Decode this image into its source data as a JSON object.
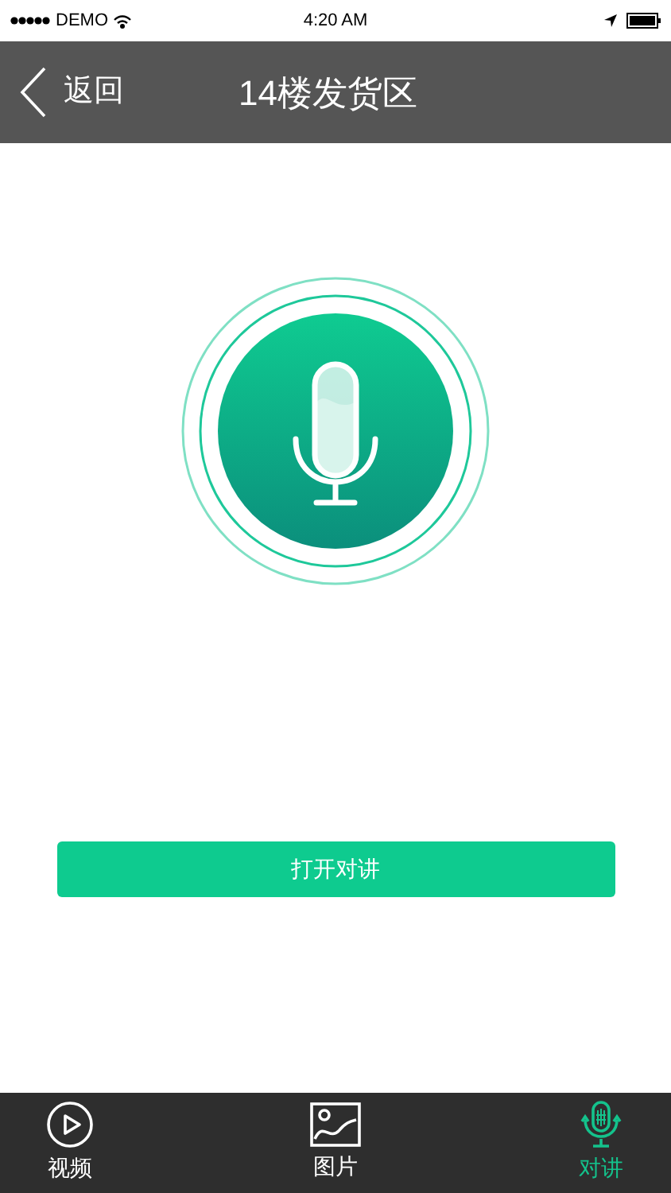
{
  "status_bar": {
    "carrier": "DEMO",
    "time": "4:20 AM"
  },
  "nav": {
    "back": "返回",
    "title": "14楼发货区"
  },
  "action_button": "打开对讲",
  "tabs": [
    {
      "kind": "video",
      "label": "视频",
      "selected": false
    },
    {
      "kind": "image",
      "label": "图片",
      "selected": false
    },
    {
      "kind": "intercom",
      "label": "对讲",
      "selected": true
    }
  ]
}
